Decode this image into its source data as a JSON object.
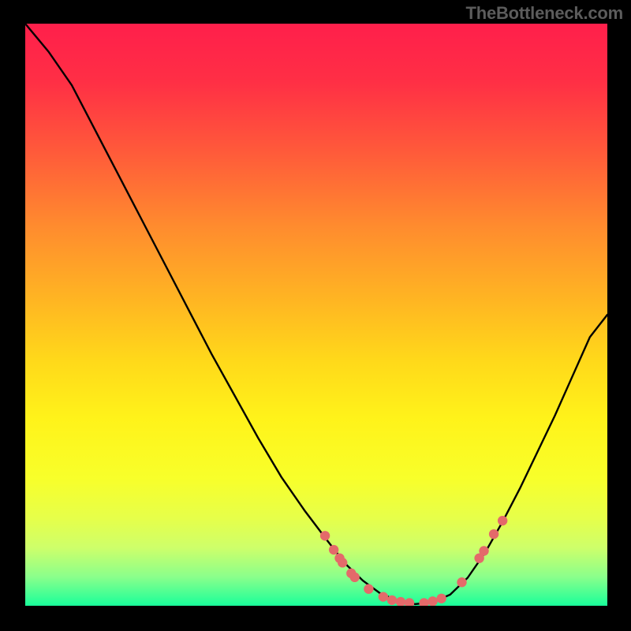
{
  "watermark": "TheBottleneck.com",
  "colors": {
    "gradient_top": "#ff1f4b",
    "gradient_bottom": "#19ff9a",
    "curve": "#000000",
    "dots": "#e46a6a",
    "frame": "#000000"
  },
  "chart_data": {
    "type": "line",
    "title": "",
    "xlabel": "",
    "ylabel": "",
    "xlim": [
      0,
      100
    ],
    "ylim": [
      0,
      104
    ],
    "grid": false,
    "legend": false,
    "series": [
      {
        "name": "bottleneck-curve",
        "x": [
          0,
          4,
          8,
          12,
          16,
          20,
          24,
          28,
          32,
          36,
          40,
          44,
          48,
          52,
          55,
          58,
          61,
          64,
          67,
          70,
          73,
          76,
          79,
          82,
          85,
          88,
          91,
          94,
          97,
          100
        ],
        "y": [
          104,
          99,
          93,
          85,
          77,
          69,
          61,
          53,
          45,
          37.5,
          30,
          23,
          17,
          11.5,
          7.5,
          4.5,
          2.2,
          0.9,
          0.3,
          0.6,
          2.0,
          5.0,
          9.5,
          15.0,
          21.0,
          27.5,
          34.0,
          41.0,
          48.0,
          52.0
        ]
      }
    ],
    "highlight_points": [
      {
        "x": 51.5,
        "y": 12.5
      },
      {
        "x": 53.0,
        "y": 10.0
      },
      {
        "x": 54.0,
        "y": 8.5
      },
      {
        "x": 54.5,
        "y": 7.7
      },
      {
        "x": 56.0,
        "y": 5.8
      },
      {
        "x": 56.6,
        "y": 5.1
      },
      {
        "x": 59.0,
        "y": 3.0
      },
      {
        "x": 61.5,
        "y": 1.6
      },
      {
        "x": 63.0,
        "y": 1.0
      },
      {
        "x": 64.5,
        "y": 0.7
      },
      {
        "x": 66.0,
        "y": 0.5
      },
      {
        "x": 68.5,
        "y": 0.5
      },
      {
        "x": 70.0,
        "y": 0.8
      },
      {
        "x": 71.5,
        "y": 1.3
      },
      {
        "x": 75.0,
        "y": 4.2
      },
      {
        "x": 78.0,
        "y": 8.5
      },
      {
        "x": 78.8,
        "y": 9.8
      },
      {
        "x": 80.5,
        "y": 12.8
      },
      {
        "x": 82.0,
        "y": 15.2
      }
    ]
  }
}
